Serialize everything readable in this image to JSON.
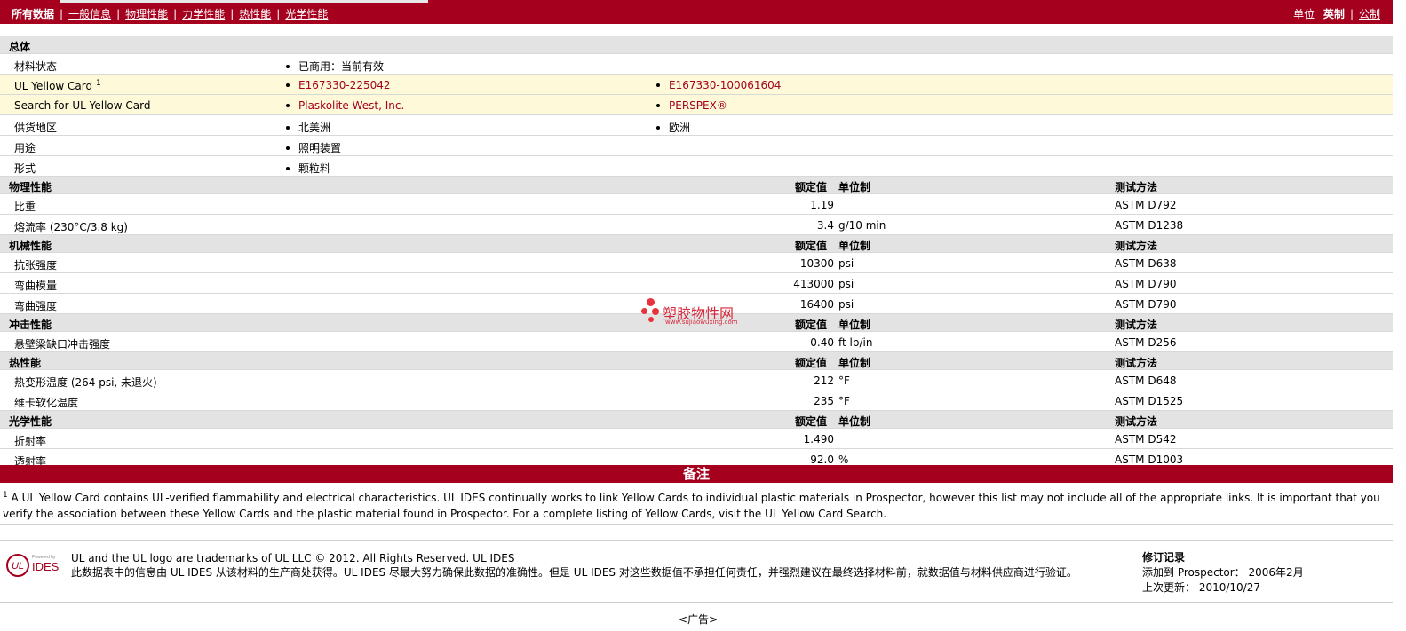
{
  "nav": {
    "all": "所有数据",
    "links": [
      "一般信息",
      "物理性能",
      "力学性能",
      "热性能",
      "光学性能"
    ],
    "units_label": "单位",
    "units_active": "英制",
    "units_other": "公制"
  },
  "general": {
    "title": "总体",
    "status_label": "材料状态",
    "status_value": "已商用：当前有效",
    "yc_label": "UL Yellow Card",
    "yc_sup": "1",
    "yc_v1": "E167330-225042",
    "yc_v2": "E167330-100061604",
    "search_label": "Search for UL Yellow Card",
    "search_v1": "Plaskolite West, Inc.",
    "search_v2": "PERSPEX®",
    "region_label": "供货地区",
    "region_v1": "北美洲",
    "region_v2": "欧洲",
    "use_label": "用途",
    "use_v1": "照明装置",
    "form_label": "形式",
    "form_v1": "颗粒料"
  },
  "col": {
    "val": "额定值",
    "unit": "单位制",
    "method": "测试方法"
  },
  "sections": {
    "phys": {
      "title": "物理性能",
      "rows": [
        {
          "label": "比重",
          "val": "1.19",
          "unit": "",
          "method": "ASTM D792"
        },
        {
          "label": "熔流率  (230°C/3.8 kg)",
          "val": "3.4",
          "unit": "g/10 min",
          "method": "ASTM D1238"
        }
      ]
    },
    "mech": {
      "title": "机械性能",
      "rows": [
        {
          "label": "抗张强度",
          "val": "10300",
          "unit": "psi",
          "method": "ASTM D638"
        },
        {
          "label": "弯曲模量",
          "val": "413000",
          "unit": "psi",
          "method": "ASTM D790"
        },
        {
          "label": "弯曲强度",
          "val": "16400",
          "unit": "psi",
          "method": "ASTM D790"
        }
      ]
    },
    "impact": {
      "title": "冲击性能",
      "rows": [
        {
          "label": "悬壁梁缺口冲击强度",
          "val": "0.40",
          "unit": "ft lb/in",
          "method": "ASTM D256"
        }
      ]
    },
    "thermal": {
      "title": "热性能",
      "rows": [
        {
          "label": "热变形温度  (264 psi, 未退火)",
          "val": "212",
          "unit": "°F",
          "method": "ASTM D648"
        },
        {
          "label": "维卡软化温度",
          "val": "235",
          "unit": "°F",
          "method": "ASTM D1525"
        }
      ]
    },
    "optical": {
      "title": "光学性能",
      "rows": [
        {
          "label": "折射率",
          "val": "1.490",
          "unit": "",
          "method": "ASTM D542"
        },
        {
          "label": "透射率",
          "val": "92.0",
          "unit": "%",
          "method": "ASTM D1003"
        }
      ]
    }
  },
  "notes": {
    "title": "备注",
    "sup": "1",
    "text": " A UL Yellow Card contains UL-verified flammability and electrical characteristics. UL IDES continually works to link Yellow Cards to individual plastic materials in Prospector, however this list may not include all of the appropriate links. It is important that you verify the association between these Yellow Cards and the plastic material found in Prospector. For a complete listing of Yellow Cards, visit the ",
    "link": "UL Yellow Card Search",
    "end": "."
  },
  "footer": {
    "logo_ul": "UL",
    "logo_powered": "Powered by",
    "logo_ides": "IDES",
    "line1": "UL and the UL logo are trademarks of UL LLC © 2012. All Rights Reserved. UL IDES",
    "line2": "此数据表中的信息由  UL IDES 从该材料的生产商处获得。UL IDES 尽最大努力确保此数据的准确性。但是  UL IDES 对这些数据值不承担任何责任，并强烈建议在最终选择材料前，就数据值与材料供应商进行验证。",
    "hist_title": "修订记录",
    "added_label": "添加到  Prospector：",
    "added_value": "2006年2月",
    "updated_label": "上次更新：",
    "updated_value": "2010/10/27",
    "ad": "<广告>"
  },
  "watermark": {
    "text": "塑胶物性网",
    "url": "www.sujiaowuxing.com"
  },
  "colors": {
    "brand": "#a5001e",
    "link_red": "#a5001e",
    "section_bg": "#e3e3e3",
    "yellow_row": "#fdf9d9"
  }
}
